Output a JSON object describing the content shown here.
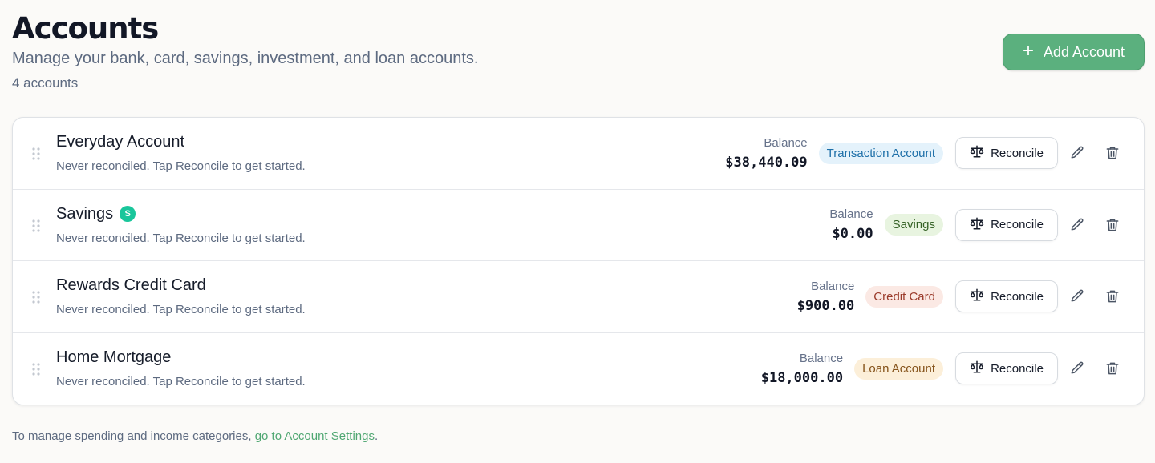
{
  "header": {
    "title": "Accounts",
    "subtitle": "Manage your bank, card, savings, investment, and loan accounts.",
    "count": "4 accounts",
    "add_button_label": "Add Account"
  },
  "accounts": [
    {
      "name": "Everyday Account",
      "status": "Never reconciled. Tap Reconcile to get started.",
      "balance_label": "Balance",
      "balance": "$38,440.09",
      "type": "Transaction Account",
      "reconcile_label": "Reconcile",
      "badge": ""
    },
    {
      "name": "Savings",
      "status": "Never reconciled. Tap Reconcile to get started.",
      "balance_label": "Balance",
      "balance": "$0.00",
      "type": "Savings",
      "reconcile_label": "Reconcile",
      "badge": "S"
    },
    {
      "name": "Rewards Credit Card",
      "status": "Never reconciled. Tap Reconcile to get started.",
      "balance_label": "Balance",
      "balance": "$900.00",
      "type": "Credit Card",
      "reconcile_label": "Reconcile",
      "badge": ""
    },
    {
      "name": "Home Mortgage",
      "status": "Never reconciled. Tap Reconcile to get started.",
      "balance_label": "Balance",
      "balance": "$18,000.00",
      "type": "Loan Account",
      "reconcile_label": "Reconcile",
      "badge": ""
    }
  ],
  "footer": {
    "text": "To manage spending and income categories, ",
    "link_text": "go to Account Settings",
    "suffix": "."
  },
  "icons": {
    "add": "plus-icon",
    "drag": "drag-handle-icon",
    "reconcile": "scale-icon",
    "edit": "pencil-icon",
    "delete": "trash-icon"
  },
  "colors": {
    "accent": "#5bb07e",
    "badge_green": "#19c69b",
    "pill_transaction_bg": "#e4f2fb",
    "pill_savings_bg": "#e8f4e0",
    "pill_credit_bg": "#fbe9e4",
    "pill_loan_bg": "#fcefd9"
  }
}
